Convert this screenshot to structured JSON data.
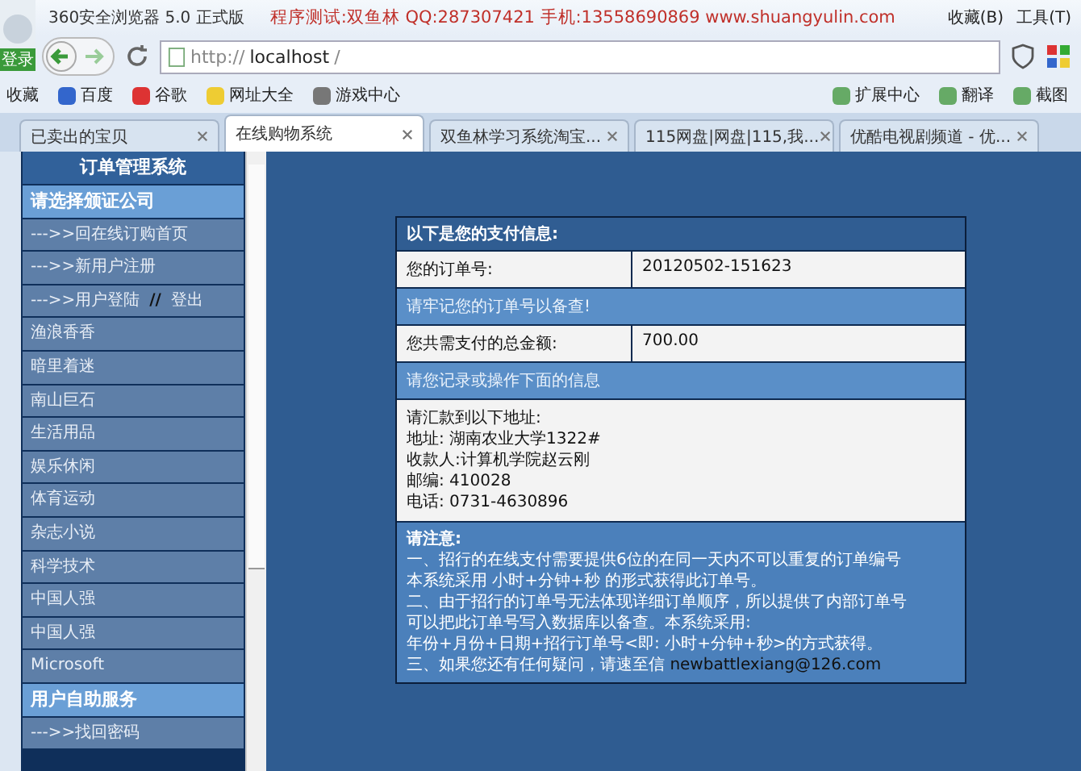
{
  "browser": {
    "title": "360安全浏览器 5.0 正式版",
    "banner": "程序测试:双鱼林 QQ:287307421 手机:13558690869 www.shuangyulin.com",
    "menus": [
      "收藏(B)",
      "工具(T)"
    ],
    "login": "登录",
    "url_scheme": "http://",
    "url_host": "localhost",
    "url_path": "/",
    "bookmarks": [
      "收藏",
      "百度",
      "谷歌",
      "网址大全",
      "游戏中心"
    ],
    "tools": [
      "扩展中心",
      "翻译",
      "截图"
    ],
    "tabs": [
      {
        "label": "已卖出的宝贝",
        "selected": false
      },
      {
        "label": "在线购物系统",
        "selected": true
      },
      {
        "label": "双鱼林学习系统淘宝...",
        "selected": false
      },
      {
        "label": "115网盘|网盘|115,我...",
        "selected": false
      },
      {
        "label": "优酷电视剧频道 - 优...",
        "selected": false
      }
    ]
  },
  "sidebar": {
    "title": "订单管理系统",
    "items": [
      {
        "kind": "header",
        "label": "请选择颁证公司"
      },
      {
        "kind": "link",
        "label": "--->>回在线订购首页"
      },
      {
        "kind": "link",
        "label": "--->>新用户注册"
      },
      {
        "kind": "login",
        "label": "--->>用户登陆",
        "sep": "//",
        "extra": "登出"
      },
      {
        "kind": "item",
        "label": "渔浪香香"
      },
      {
        "kind": "item",
        "label": "暗里着迷"
      },
      {
        "kind": "item",
        "label": "南山巨石"
      },
      {
        "kind": "item",
        "label": "生活用品"
      },
      {
        "kind": "item",
        "label": "娱乐休闲"
      },
      {
        "kind": "item",
        "label": "体育运动"
      },
      {
        "kind": "item",
        "label": "杂志小说"
      },
      {
        "kind": "item",
        "label": "科学技术"
      },
      {
        "kind": "item",
        "label": "中国人强"
      },
      {
        "kind": "item",
        "label": "中国人强"
      },
      {
        "kind": "item",
        "label": "Microsoft"
      },
      {
        "kind": "header",
        "label": "用户自助服务"
      },
      {
        "kind": "link",
        "label": "--->>找回密码"
      }
    ]
  },
  "payment": {
    "title": "以下是您的支付信息:",
    "rows": [
      {
        "kind": "field",
        "label": "您的订单号:",
        "value": "20120502-151623"
      },
      {
        "kind": "notice",
        "label": "请牢记您的订单号以备查!"
      },
      {
        "kind": "field",
        "label": "您共需支付的总金额:",
        "value": "700.00"
      },
      {
        "kind": "notice",
        "label": "请您记录或操作下面的信息"
      },
      {
        "kind": "address",
        "lines": [
          "请汇款到以下地址:",
          "地址: 湖南农业大学1322#",
          "收款人:计算机学院赵云刚",
          "邮编: 410028",
          "电话: 0731-4630896"
        ]
      }
    ],
    "note_title": "请注意:",
    "note_lines": [
      "一、招行的在线支付需要提供6位的在同一天内不可以重复的订单编号",
      "本系统采用 小时+分钟+秒 的形式获得此订单号。",
      "二、由于招行的订单号无法体现详细订单顺序，所以提供了内部订单号",
      "可以把此订单号写入数据库以备查。本系统采用:",
      "年份+月份+日期+招行订单号<即: 小时+分钟+秒>的方式获得。",
      "三、如果您还有任何疑问，请速至信"
    ],
    "email": "newbattlexiang@126.com"
  }
}
